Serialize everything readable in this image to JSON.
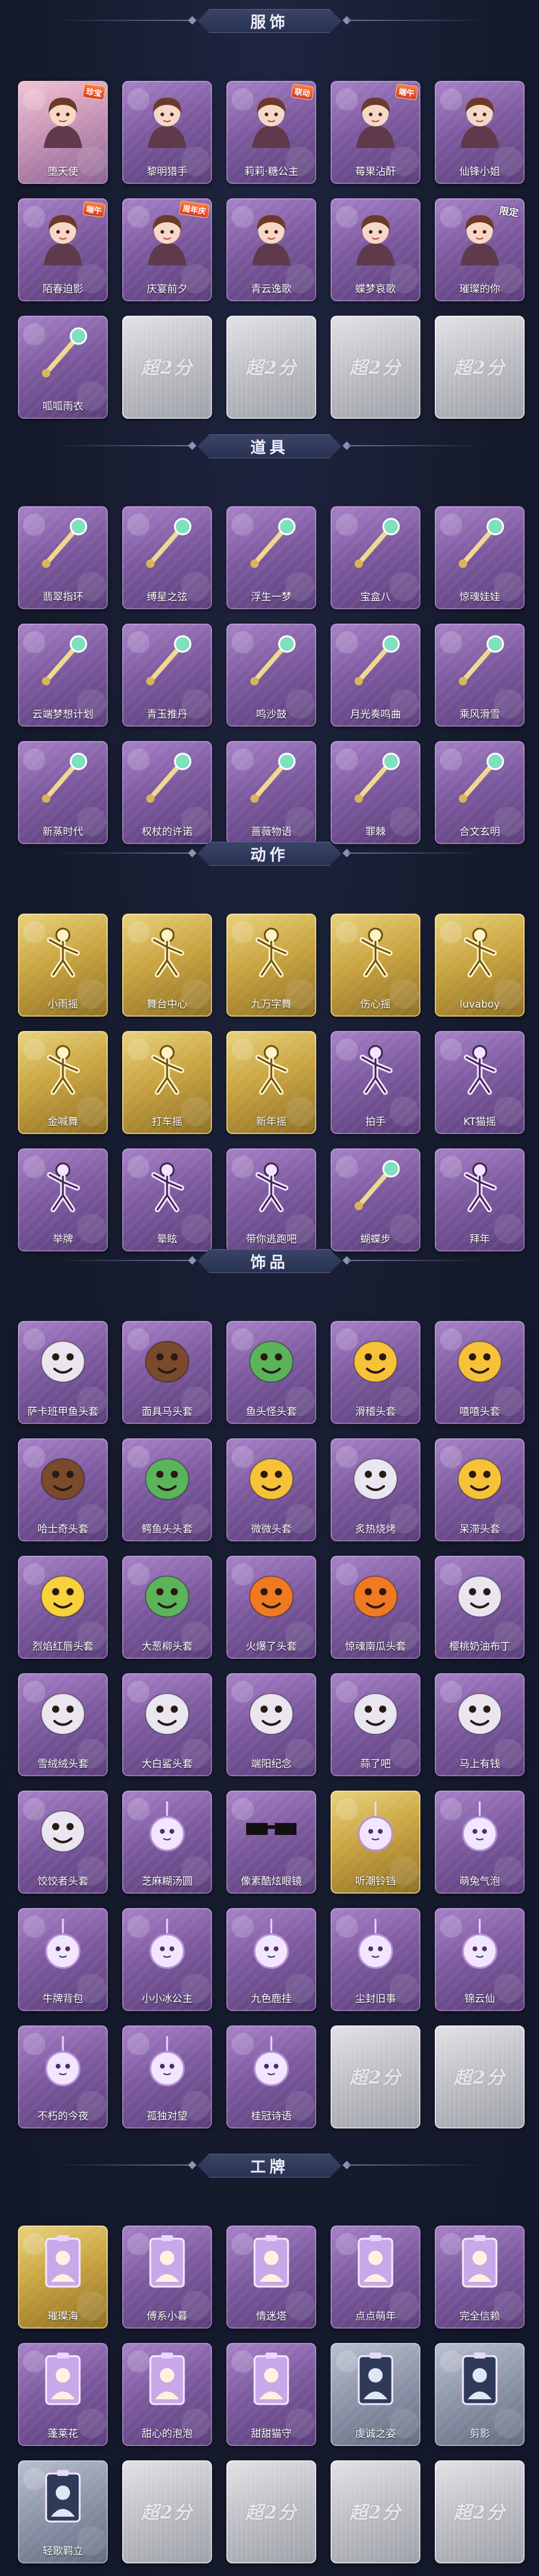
{
  "sections": [
    {
      "title": "服饰",
      "items": [
        {
          "label": "堕天使",
          "theme": "pinkish",
          "icon": "angel-costume-icon",
          "badge": "珍宝"
        },
        {
          "label": "黎明猎手",
          "theme": "purple",
          "icon": "hunter-costume-icon"
        },
        {
          "label": "莉莉·糖公主",
          "theme": "purple",
          "icon": "princess-costume-icon",
          "badge": "联动"
        },
        {
          "label": "莓果沾酐",
          "theme": "purple",
          "icon": "berry-costume-icon",
          "badge": "端午"
        },
        {
          "label": "仙锋小姐",
          "theme": "purple",
          "icon": "lady-costume-icon"
        },
        {
          "label": "陌春迫影",
          "theme": "purple",
          "icon": "spring-costume-icon",
          "badge": "端午"
        },
        {
          "label": "庆宴前夕",
          "theme": "purple",
          "icon": "feast-costume-icon",
          "badge": "周年庆"
        },
        {
          "label": "青云逸歌",
          "theme": "purple",
          "icon": "cloud-costume-icon"
        },
        {
          "label": "蝶梦哀歌",
          "theme": "purple",
          "icon": "butterfly-costume-icon"
        },
        {
          "label": "璀璨的你",
          "theme": "purple",
          "icon": "shining-costume-icon",
          "badge": "限定"
        },
        {
          "label": "呱呱雨衣",
          "theme": "purple",
          "icon": "frog-raincoat-icon"
        },
        {
          "label": "",
          "theme": "empty",
          "watermark": "超2分"
        },
        {
          "label": "",
          "theme": "empty",
          "watermark": "超2分"
        },
        {
          "label": "",
          "theme": "empty",
          "watermark": "超2分"
        },
        {
          "label": "",
          "theme": "empty",
          "watermark": "超2分"
        }
      ]
    },
    {
      "title": "道具",
      "items": [
        {
          "label": "翡翠指环",
          "theme": "purple",
          "icon": "jade-ring-icon"
        },
        {
          "label": "缚星之弦",
          "theme": "purple",
          "icon": "star-string-icon"
        },
        {
          "label": "浮生一梦",
          "theme": "purple",
          "icon": "hourglass-icon"
        },
        {
          "label": "宝盒八",
          "theme": "purple",
          "icon": "heart-box-icon"
        },
        {
          "label": "惊魂娃娃",
          "theme": "purple",
          "icon": "skull-doll-icon"
        },
        {
          "label": "云端梦想计划",
          "theme": "purple",
          "icon": "dream-scepter-icon"
        },
        {
          "label": "青玉推丹",
          "theme": "purple",
          "icon": "jade-bottle-icon"
        },
        {
          "label": "鸣沙鼓",
          "theme": "purple",
          "icon": "sand-drum-icon"
        },
        {
          "label": "月光奏鸣曲",
          "theme": "purple",
          "icon": "moon-harp-icon"
        },
        {
          "label": "乘风滑雪",
          "theme": "purple",
          "icon": "ski-icon"
        },
        {
          "label": "新蒸时代",
          "theme": "purple",
          "icon": "steam-gun-icon"
        },
        {
          "label": "权杖的许诺",
          "theme": "purple",
          "icon": "scepter-icon"
        },
        {
          "label": "蔷薇物语",
          "theme": "purple",
          "icon": "rose-box-icon"
        },
        {
          "label": "罪棘",
          "theme": "purple",
          "icon": "thorn-spear-icon"
        },
        {
          "label": "合文玄明",
          "theme": "purple",
          "icon": "lantern-icon"
        }
      ]
    },
    {
      "title": "动作",
      "items": [
        {
          "label": "小雨摇",
          "theme": "gold",
          "icon": "dance-pose-icon"
        },
        {
          "label": "舞台中心",
          "theme": "gold",
          "icon": "stage-pose-icon"
        },
        {
          "label": "九万字舞",
          "theme": "gold",
          "icon": "dance-pose-icon"
        },
        {
          "label": "伤心摇",
          "theme": "gold",
          "icon": "sad-pose-icon"
        },
        {
          "label": "luvaboy",
          "theme": "gold",
          "icon": "heart-pose-icon"
        },
        {
          "label": "金喊舞",
          "theme": "gold",
          "icon": "dance-pose-icon"
        },
        {
          "label": "打车摇",
          "theme": "gold",
          "icon": "taxi-pose-icon"
        },
        {
          "label": "新年摇",
          "theme": "gold",
          "icon": "newyear-pose-icon"
        },
        {
          "label": "拍手",
          "theme": "purple",
          "icon": "clap-pose-icon"
        },
        {
          "label": "KT猫摇",
          "theme": "purple",
          "icon": "cat-pose-icon"
        },
        {
          "label": "举牌",
          "theme": "purple",
          "icon": "sign-pose-icon"
        },
        {
          "label": "晕眩",
          "theme": "purple",
          "icon": "dizzy-pose-icon"
        },
        {
          "label": "带你逃跑吧",
          "theme": "purple",
          "icon": "run-pose-icon"
        },
        {
          "label": "蝴蝶步",
          "theme": "purple",
          "icon": "butterfly-step-icon"
        },
        {
          "label": "拜年",
          "theme": "purple",
          "icon": "bow-pose-icon"
        }
      ]
    },
    {
      "title": "饰品",
      "items": [
        {
          "label": "萨卡班甲鱼头套",
          "theme": "purple",
          "icon": "fish-head-icon"
        },
        {
          "label": "面具马头套",
          "theme": "purple",
          "icon": "horse-head-icon"
        },
        {
          "label": "鱼头怪头套",
          "theme": "purple",
          "icon": "fish-man-head-icon"
        },
        {
          "label": "滑稽头套",
          "theme": "purple",
          "icon": "funny-face-icon"
        },
        {
          "label": "嘻嘻头套",
          "theme": "purple",
          "icon": "grin-face-icon"
        },
        {
          "label": "哈士奇头套",
          "theme": "purple",
          "icon": "husky-head-icon"
        },
        {
          "label": "鳄鱼头头套",
          "theme": "purple",
          "icon": "crocodile-head-icon"
        },
        {
          "label": "微微头套",
          "theme": "purple",
          "icon": "smile-face-icon"
        },
        {
          "label": "炙热烧烤",
          "theme": "purple",
          "icon": "toast-head-icon"
        },
        {
          "label": "呆滞头套",
          "theme": "purple",
          "icon": "stunned-face-icon"
        },
        {
          "label": "烈焰红唇头套",
          "theme": "purple",
          "icon": "pikachu-head-icon"
        },
        {
          "label": "大葱柳头套",
          "theme": "purple",
          "icon": "scallion-head-icon"
        },
        {
          "label": "火爆了头套",
          "theme": "purple",
          "icon": "fire-head-icon"
        },
        {
          "label": "惊魂南瓜头套",
          "theme": "purple",
          "icon": "pumpkin-head-icon"
        },
        {
          "label": "樱桃奶油布丁",
          "theme": "purple",
          "icon": "pudding-head-icon"
        },
        {
          "label": "雪绒绒头套",
          "theme": "purple",
          "icon": "snow-head-icon"
        },
        {
          "label": "大白鲨头套",
          "theme": "purple",
          "icon": "shark-head-icon"
        },
        {
          "label": "端阳纪念",
          "theme": "purple",
          "icon": "dumpling-head-icon"
        },
        {
          "label": "蒜了吧",
          "theme": "purple",
          "icon": "garlic-head-icon"
        },
        {
          "label": "马上有钱",
          "theme": "purple",
          "icon": "rich-head-icon"
        },
        {
          "label": "饺饺者头套",
          "theme": "purple",
          "icon": "dumpling-face-icon"
        },
        {
          "label": "芝麻糊汤圆",
          "theme": "purple",
          "icon": "tangyuan-icon"
        },
        {
          "label": "像素酷炫眼镜",
          "theme": "purple",
          "icon": "pixel-glasses-icon"
        },
        {
          "label": "听潮铃铛",
          "theme": "gold",
          "icon": "bell-icon"
        },
        {
          "label": "萌兔气泡",
          "theme": "purple",
          "icon": "bubble-icon"
        },
        {
          "label": "牛牌背包",
          "theme": "purple",
          "icon": "cake-bag-icon"
        },
        {
          "label": "小小冰公主",
          "theme": "purple",
          "icon": "ice-princess-icon"
        },
        {
          "label": "九色鹿挂",
          "theme": "purple",
          "icon": "deer-pendant-icon"
        },
        {
          "label": "尘封旧事",
          "theme": "purple",
          "icon": "figure-pendant-icon"
        },
        {
          "label": "锦云仙",
          "theme": "purple",
          "icon": "cloud-pendant-icon"
        },
        {
          "label": "不朽的今夜",
          "theme": "purple",
          "icon": "night-pendant-icon"
        },
        {
          "label": "孤独对望",
          "theme": "purple",
          "icon": "gaze-pendant-icon"
        },
        {
          "label": "桂冠诗语",
          "theme": "purple",
          "icon": "poet-pendant-icon"
        },
        {
          "label": "",
          "theme": "empty",
          "watermark": "超2分"
        },
        {
          "label": "",
          "theme": "empty",
          "watermark": "超2分"
        }
      ]
    },
    {
      "title": "工牌",
      "items": [
        {
          "label": "璀璨海",
          "theme": "gold",
          "icon": "badge-card-icon"
        },
        {
          "label": "傅系小暮",
          "theme": "purple",
          "icon": "badge-card-icon"
        },
        {
          "label": "情迷塔",
          "theme": "purple",
          "icon": "badge-card-icon"
        },
        {
          "label": "点点萌年",
          "theme": "purple",
          "icon": "badge-card-icon"
        },
        {
          "label": "完全信赖",
          "theme": "purple",
          "icon": "badge-card-icon"
        },
        {
          "label": "蓬莱花",
          "theme": "purple",
          "icon": "badge-card-icon"
        },
        {
          "label": "甜心的泡泡",
          "theme": "purple",
          "icon": "badge-card-icon"
        },
        {
          "label": "甜甜猫守",
          "theme": "purple",
          "icon": "badge-card-icon"
        },
        {
          "label": "虔诚之姿",
          "theme": "silver",
          "icon": "silhouette-card-icon"
        },
        {
          "label": "剪影",
          "theme": "silver",
          "icon": "silhouette-card-icon"
        },
        {
          "label": "轻歌羁立",
          "theme": "silver",
          "icon": "silhouette-card-icon"
        },
        {
          "label": "",
          "theme": "empty",
          "watermark": "超2分"
        },
        {
          "label": "",
          "theme": "empty",
          "watermark": "超2分"
        },
        {
          "label": "",
          "theme": "empty",
          "watermark": "超2分"
        },
        {
          "label": "",
          "theme": "empty",
          "watermark": "超2分"
        }
      ]
    }
  ]
}
